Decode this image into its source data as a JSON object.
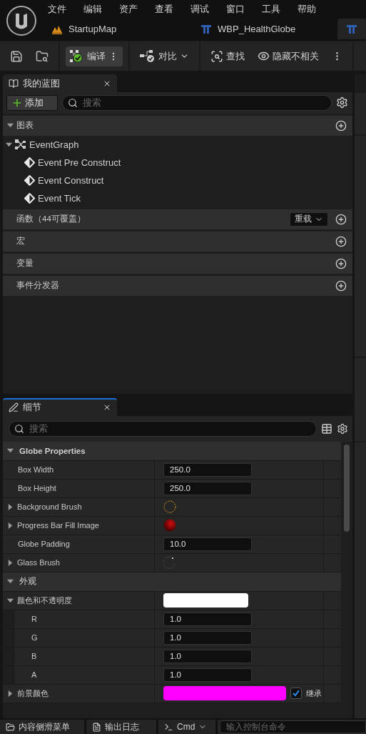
{
  "menu": [
    "文件",
    "编辑",
    "资产",
    "查看",
    "调试",
    "窗口",
    "工具",
    "帮助"
  ],
  "doc_tabs": [
    {
      "kind": "level",
      "label": "StartupMap",
      "selected": false
    },
    {
      "kind": "widget",
      "label": "WBP_HealthGlobe",
      "selected": false
    },
    {
      "kind": "widget",
      "selected": true
    }
  ],
  "toolbar": [
    {
      "kind": "save"
    },
    {
      "kind": "browse"
    },
    {
      "kind": "compile",
      "label": "编译"
    },
    {
      "kind": "diff",
      "label": "对比"
    },
    {
      "kind": "find",
      "label": "查找"
    },
    {
      "kind": "hide",
      "label": "隐藏不相关"
    },
    {
      "kind": "more"
    }
  ],
  "my_blueprint": {
    "title": "我的蓝图",
    "focused": false,
    "add_label": "添加",
    "search_placeholder": "搜索",
    "sections": [
      {
        "label": "图表",
        "expanded": true,
        "items": [
          {
            "kind": "graph",
            "label": "EventGraph",
            "expanded": true,
            "children": [
              {
                "kind": "event",
                "label": "Event Pre Construct"
              },
              {
                "kind": "event",
                "label": "Event Construct"
              },
              {
                "kind": "event",
                "label": "Event Tick"
              }
            ]
          }
        ]
      },
      {
        "label": "函数（44可覆盖）",
        "override_label": "重载"
      },
      {
        "label": "宏"
      },
      {
        "label": "变量"
      },
      {
        "label": "事件分发器"
      }
    ]
  },
  "details": {
    "title": "细节",
    "focused": true,
    "search_placeholder": "搜索",
    "categories": [
      {
        "label": "Globe Properties",
        "expanded": true,
        "rows": [
          {
            "kind": "number",
            "label": "Box Width",
            "value": "250.0"
          },
          {
            "kind": "number",
            "label": "Box Height",
            "value": "250.0"
          },
          {
            "kind": "ring_brush",
            "label": "Background Brush",
            "expanded": false
          },
          {
            "kind": "sphere_brush",
            "label": "Progress Bar Fill Image",
            "expanded": false
          },
          {
            "kind": "number",
            "label": "Globe Padding",
            "value": "10.0"
          },
          {
            "kind": "glass_brush",
            "label": "Glass Brush",
            "expanded": false
          }
        ]
      },
      {
        "label": "外观",
        "expanded": true,
        "rows": [
          {
            "kind": "color",
            "label": "颜色和不透明度",
            "expanded": true,
            "color": "#ffffff",
            "children": [
              {
                "kind": "number",
                "label": "R",
                "value": "1.0"
              },
              {
                "kind": "number",
                "label": "G",
                "value": "1.0"
              },
              {
                "kind": "number",
                "label": "B",
                "value": "1.0"
              },
              {
                "kind": "number",
                "label": "A",
                "value": "1.0"
              }
            ]
          },
          {
            "kind": "color",
            "label": "前景颜色",
            "expanded": false,
            "color": "#ff00ff",
            "inherit": {
              "label": "继承",
              "checked": true
            }
          }
        ]
      }
    ]
  },
  "bottom_bar": {
    "tabs": [
      {
        "kind": "drawer",
        "label": "内容侧滑菜单"
      },
      {
        "kind": "log",
        "label": "输出日志"
      },
      {
        "kind": "cmd",
        "label": "Cmd"
      }
    ],
    "console_placeholder": "输入控制台命令"
  }
}
